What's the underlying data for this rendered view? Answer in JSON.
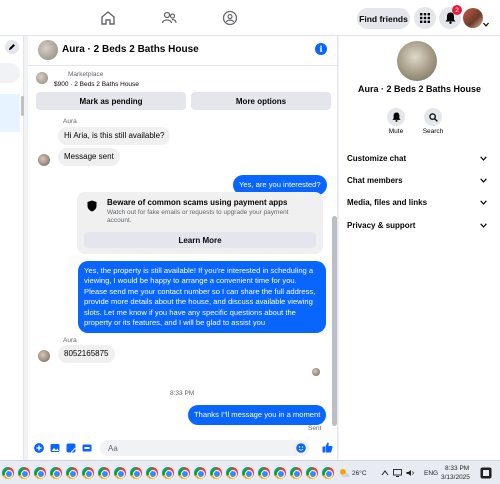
{
  "topnav": {
    "find_friends": "Find friends",
    "notification_count": "2"
  },
  "chat": {
    "title": "Aura · 2 Beds 2 Baths House",
    "marketplace_label": "Marketplace",
    "listing": "$900 · 2 Beds 2 Baths House",
    "mark_pending": "Mark as pending",
    "more_options": "More options",
    "sender_name": "Aura",
    "msg1": "Hi Aria, is this still available?",
    "msg2": "Message sent",
    "msg3": "Yes, are you interested?",
    "scam_title": "Beware of common scams using payment apps",
    "scam_text": "Watch out for fake emails or requests to upgrade your payment account.",
    "learn_more": "Learn More",
    "msg4": "Yes, the property is still available! If you're interested in scheduling a viewing, I would be happy to arrange a convenient time for you. Please send me your contact number so I can share the full address, provide more details about the house, and discuss available viewing slots. Let me know if you have any specific questions about the property or its features, and I will be glad to assist you",
    "sender_name2": "Aura",
    "msg5": "8052165875",
    "time": "8:33 PM",
    "msg6": "Thanks I\"ll message you in a moment",
    "sent": "Sent",
    "composer_placeholder": "Aa"
  },
  "right_panel": {
    "title": "Aura · 2 Beds 2 Baths House",
    "mute": "Mute",
    "search": "Search",
    "items": [
      "Customize chat",
      "Chat members",
      "Media, files and links",
      "Privacy & support"
    ]
  },
  "taskbar": {
    "temperature": "26°C",
    "language": "ENG",
    "clock_time": "8:33 PM",
    "clock_date": "3/13/2025"
  },
  "colors": {
    "accent": "#0866ff",
    "badge": "#e41e3f"
  }
}
